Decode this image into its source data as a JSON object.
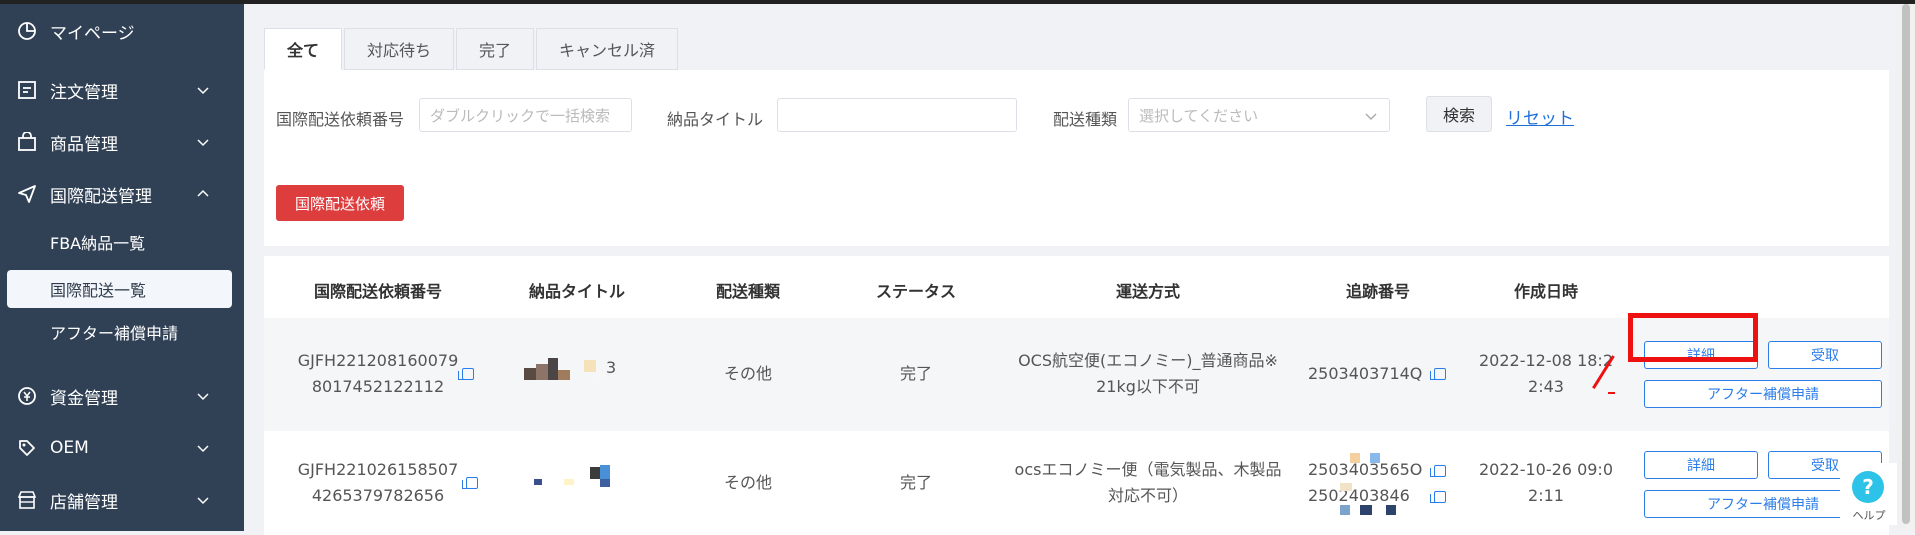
{
  "sidebar": {
    "items": [
      {
        "label": "マイページ",
        "icon": "chart-pie-icon"
      },
      {
        "label": "注文管理",
        "icon": "list-icon"
      },
      {
        "label": "商品管理",
        "icon": "bag-icon"
      },
      {
        "label": "国際配送管理",
        "icon": "send-icon"
      },
      {
        "label": "資金管理",
        "icon": "yen-icon"
      },
      {
        "label": "OEM",
        "icon": "tag-icon"
      },
      {
        "label": "店舗管理",
        "icon": "store-icon"
      }
    ],
    "subitems": [
      "FBA納品一覧",
      "国際配送一覧",
      "アフター補償申請"
    ]
  },
  "tabs": [
    "全て",
    "対応待ち",
    "完了",
    "キャンセル済"
  ],
  "filters": {
    "shipping_no_label": "国際配送依頼番号",
    "shipping_no_placeholder": "ダブルクリックで一括検索",
    "title_label": "納品タイトル",
    "type_label": "配送種類",
    "type_placeholder": "選択してください",
    "search_button": "検索",
    "reset_link": "リセット"
  },
  "create_button": "国際配送依頼",
  "table": {
    "headers": [
      "国際配送依頼番号",
      "納品タイトル",
      "配送種類",
      "ステータス",
      "運送方式",
      "追跡番号",
      "作成日時"
    ],
    "rows": [
      {
        "no_line1": "GJFH221208160079",
        "no_line2": "8017452122112",
        "title_fragment": "3",
        "type": "その他",
        "status": "完了",
        "method_line1": "OCS航空便(エコノミー)_普通商品※",
        "method_line2": "21kg以下不可",
        "tracking1": "2503403714Q",
        "date_line1": "2022-12-08 18:2",
        "date_line2": "2:43",
        "detail_btn": "詳細",
        "receive_btn": "受取",
        "after_btn": "アフター補償申請"
      },
      {
        "no_line1": "GJFH221026158507",
        "no_line2": "4265379782656",
        "type": "その他",
        "status": "完了",
        "method_line1": "ocsエコノミー便（電気製品、木製品",
        "method_line2": "対応不可）",
        "tracking1": "2503403565O",
        "tracking2": "2502403846",
        "date_line1": "2022-10-26 09:0",
        "date_line2": "2:11",
        "detail_btn": "詳細",
        "receive_btn": "受取",
        "after_btn": "アフター補償申請"
      }
    ]
  },
  "help_label": "ヘルプ",
  "colors": {
    "sidebar": "#304156",
    "accent": "#2b7de9",
    "danger": "#dd3d3d",
    "highlight": "#ee1111"
  }
}
